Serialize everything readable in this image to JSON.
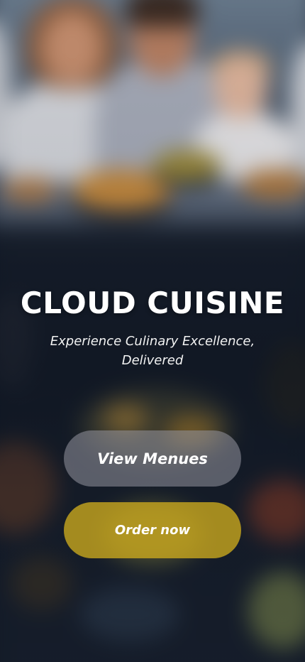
{
  "app": {
    "title": "CLOUD CUISINE",
    "tagline": "Experience Culinary Excellence, Delivered"
  },
  "actions": {
    "view_menus_label": "View Menues",
    "order_now_label": "Order now"
  },
  "colors": {
    "view_menus_bg": "#96969f",
    "order_now_bg": "#cdaa1e",
    "text": "#ffffff"
  }
}
